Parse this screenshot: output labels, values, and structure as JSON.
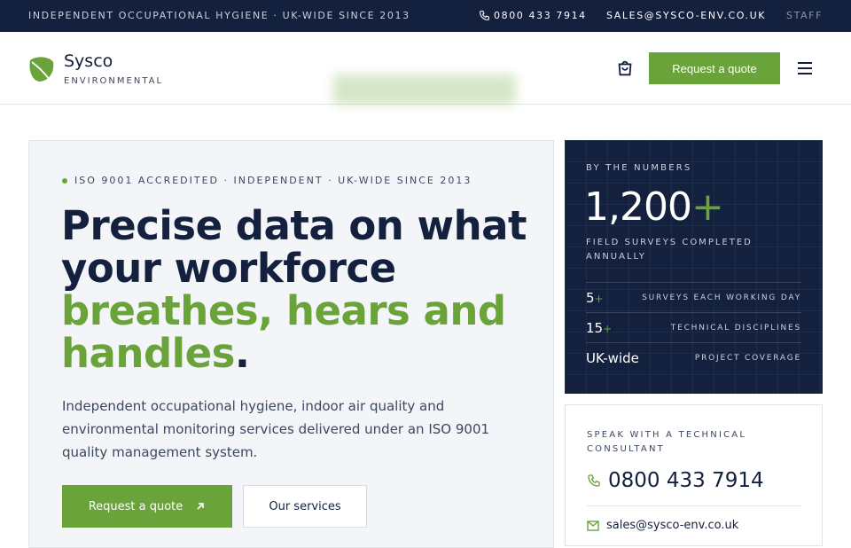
{
  "topbar": {
    "tagline": "INDEPENDENT OCCUPATIONAL HYGIENE · UK-WIDE SINCE 2013",
    "phone": "0800 433 7914",
    "email": "SALES@SYSCO-ENV.CO.UK",
    "staff": "STAFF"
  },
  "header": {
    "brand": "Sysco",
    "brand_sub": "ENVIRONMENTAL",
    "quote_button": "Request a quote"
  },
  "hero": {
    "eyebrow": "ISO 9001 ACCREDITED · INDEPENDENT · UK-WIDE SINCE 2013",
    "headline_dark_1": "Precise data on what",
    "headline_dark_2": "your workforce",
    "headline_green_1": "breathes, hears and",
    "headline_green_2": "handles",
    "headline_end": ".",
    "lead": "Independent occupational hygiene, indoor air quality and environmental monitoring services delivered under an ISO 9001 quality management system.",
    "primary_button": "Request a quote",
    "secondary_button": "Our services"
  },
  "numbers": {
    "label": "BY THE NUMBERS",
    "big_value": "1,200",
    "big_suffix": "+",
    "big_caption": "FIELD SURVEYS COMPLETED ANNUALLY",
    "stats": [
      {
        "value": "5",
        "suffix": "+",
        "label": "SURVEYS EACH WORKING DAY"
      },
      {
        "value": "15",
        "suffix": "+",
        "label": "TECHNICAL DISCIPLINES"
      },
      {
        "value": "UK-wide",
        "suffix": "",
        "label": "PROJECT COVERAGE"
      }
    ]
  },
  "contact": {
    "label": "SPEAK WITH A TECHNICAL CONSULTANT",
    "phone": "0800 433 7914",
    "email": "sales@sysco-env.co.uk"
  },
  "colors": {
    "navy": "#13213f",
    "accent_green": "#6aa339",
    "hero_bg": "#f3f5f8"
  },
  "icons": [
    "phone-icon",
    "leaf-logo-icon",
    "cart-icon",
    "menu-icon",
    "arrow-up-right-icon",
    "mail-icon"
  ]
}
